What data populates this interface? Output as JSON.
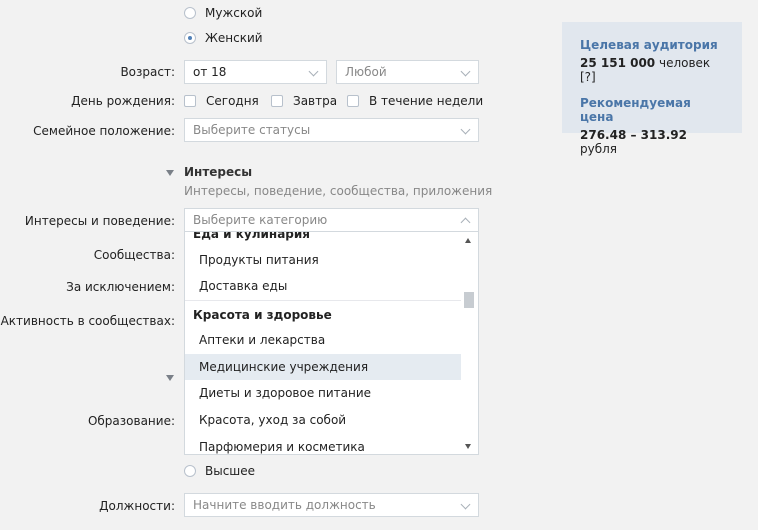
{
  "gender": {
    "male_label": "Мужской",
    "female_label": "Женский",
    "selected": "female"
  },
  "age": {
    "label": "Возраст:",
    "from_value": "от 18",
    "to_value": "Любой"
  },
  "birthday": {
    "label": "День рождения:",
    "options": [
      "Сегодня",
      "Завтра",
      "В течение недели"
    ]
  },
  "marital": {
    "label": "Семейное положение:",
    "placeholder": "Выберите статусы"
  },
  "interests": {
    "title": "Интересы",
    "subtitle": "Интересы, поведение, сообщества, приложения",
    "behavior_label": "Интересы и поведение:",
    "behavior_placeholder": "Выберите категорию",
    "communities_label": "Сообщества:",
    "except_label": "За исключением:",
    "activity_label": "Активность в сообществах:"
  },
  "dropdown": {
    "group1": "Еда и кулинария",
    "group1_items": [
      "Продукты питания",
      "Доставка еды"
    ],
    "group2": "Красота и здоровье",
    "group2_items": [
      "Аптеки и лекарства",
      "Медицинские учреждения",
      "Диеты и здоровое питание",
      "Красота, уход за собой",
      "Парфюмерия и косметика"
    ],
    "hovered": "Медицинские учреждения"
  },
  "education": {
    "label": "Образование:",
    "higher_label": "Высшее"
  },
  "positions": {
    "label": "Должности:",
    "placeholder": "Начните вводить должность"
  },
  "audience": {
    "title": "Целевая аудитория",
    "count": "25 151 000",
    "count_suffix": "человек",
    "help": "[?]",
    "price_title": "Рекомендуемая цена",
    "price_range": "276.48 – 313.92",
    "price_suffix": "рубля"
  },
  "colors": {
    "accent": "#4a76a8",
    "hover": "#e5ebf1",
    "panel": "#e1e7ee"
  }
}
